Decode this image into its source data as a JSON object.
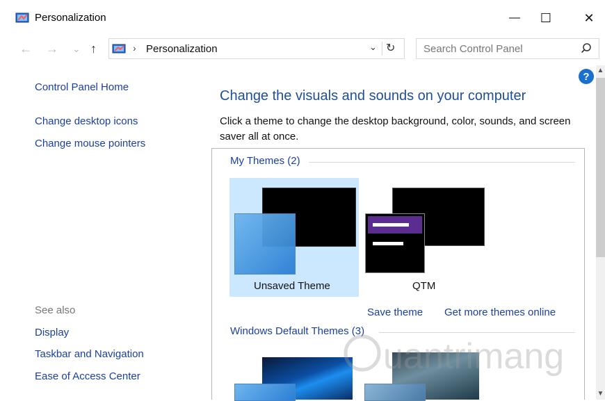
{
  "window": {
    "title": "Personalization",
    "minimize_glyph": "—",
    "maximize_glyph": "☐",
    "close_glyph": "✕"
  },
  "nav": {
    "back_icon": "←",
    "forward_icon": "→",
    "recent_icon": "⌄",
    "up_icon": "↑",
    "address_separator": "›",
    "address_path": "Personalization",
    "address_dropdown": "⌄",
    "refresh_icon": "↻",
    "search_placeholder": "Search Control Panel"
  },
  "sidebar": {
    "home": "Control Panel Home",
    "tasks": [
      "Change desktop icons",
      "Change mouse pointers"
    ],
    "see_also_label": "See also",
    "see_also": [
      "Display",
      "Taskbar and Navigation",
      "Ease of Access Center"
    ]
  },
  "main": {
    "title": "Change the visuals and sounds on your computer",
    "description": "Click a theme to change the desktop background, color, sounds, and screen saver all at once.",
    "my_themes_label": "My Themes (2)",
    "themes": [
      {
        "name": "Unsaved Theme",
        "selected": true
      },
      {
        "name": "QTM",
        "selected": false
      }
    ],
    "save_theme": "Save theme",
    "get_more": "Get more themes online",
    "default_themes_label": "Windows Default Themes (3)",
    "help": "?"
  },
  "watermark": {
    "text": "Quantrimang"
  },
  "colors": {
    "link": "#1a3fa2",
    "title": "#1e4e9a",
    "selection": "#cce8ff",
    "accent": "#5c2d91"
  }
}
